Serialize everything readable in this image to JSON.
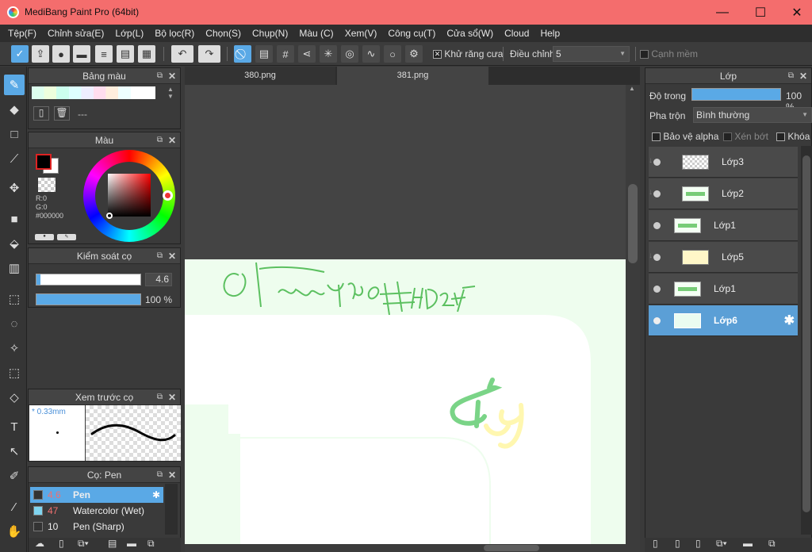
{
  "window": {
    "title": "MediBang Paint Pro (64bit)",
    "min": "—",
    "max": "☐",
    "close": "✕"
  },
  "menu": [
    "Tệp(F)",
    "Chỉnh sửa(E)",
    "Lớp(L)",
    "Bộ lọc(R)",
    "Chọn(S)",
    "Chụp(N)",
    "Màu (C)",
    "Xem(V)",
    "Công cụ(T)",
    "Cửa sổ(W)",
    "Cloud",
    "Help"
  ],
  "toolbar": {
    "antialias_label": "Khử răng cưa",
    "adjust_label": "Điều chỉnh",
    "adjust_value": "5",
    "soft_edge_label": "Cạnh mềm"
  },
  "palette_panel": {
    "title": "Bảng màu",
    "value": "---"
  },
  "color_panel": {
    "title": "Màu",
    "r": "R:0",
    "g": "G:0",
    "hex": "#000000",
    "fg_color": "#000000"
  },
  "brush_control": {
    "title": "Kiểm soát cọ",
    "size": "4.6",
    "size_fraction": 0.04,
    "opacity": "100 %",
    "opacity_fraction": 1.0
  },
  "brush_preview": {
    "title": "Xem trước cọ",
    "size_label": "* 0.33mm"
  },
  "brush_list": {
    "title": "Cọ: Pen",
    "items": [
      {
        "size": "4.6",
        "name": "Pen",
        "swatch": "#333333"
      },
      {
        "size": "47",
        "name": "Watercolor (Wet)",
        "swatch": "#7fd4ef"
      },
      {
        "size": "10",
        "name": "Pen (Sharp)",
        "swatch": "#333333"
      }
    ]
  },
  "tabs": [
    {
      "label": "380.png"
    },
    {
      "label": "381.png"
    }
  ],
  "layers_panel": {
    "title": "Lớp",
    "opacity_label": "Độ trong",
    "opacity_value": "100 %",
    "opacity_fraction": 1.0,
    "blend_label": "Pha trộn",
    "blend_value": "Bình thường",
    "protect_alpha": "Bảo vệ alpha",
    "clip": "Xén bớt",
    "lock": "Khóa",
    "layers": [
      {
        "name": "Lớp3",
        "thumb": "checker"
      },
      {
        "name": "Lớp2",
        "thumb": "green"
      },
      {
        "name": "Lớp1",
        "thumb": "green"
      },
      {
        "name": "Lớp5",
        "thumb": "yellow"
      },
      {
        "name": "Lớp1",
        "thumb": "green"
      },
      {
        "name": "Lớp6",
        "thumb": "mint",
        "selected": true
      }
    ]
  },
  "colors": {
    "accent": "#5aa9e6",
    "titlebar": "#f46d6d",
    "canvas_bg": "#eefdee"
  }
}
